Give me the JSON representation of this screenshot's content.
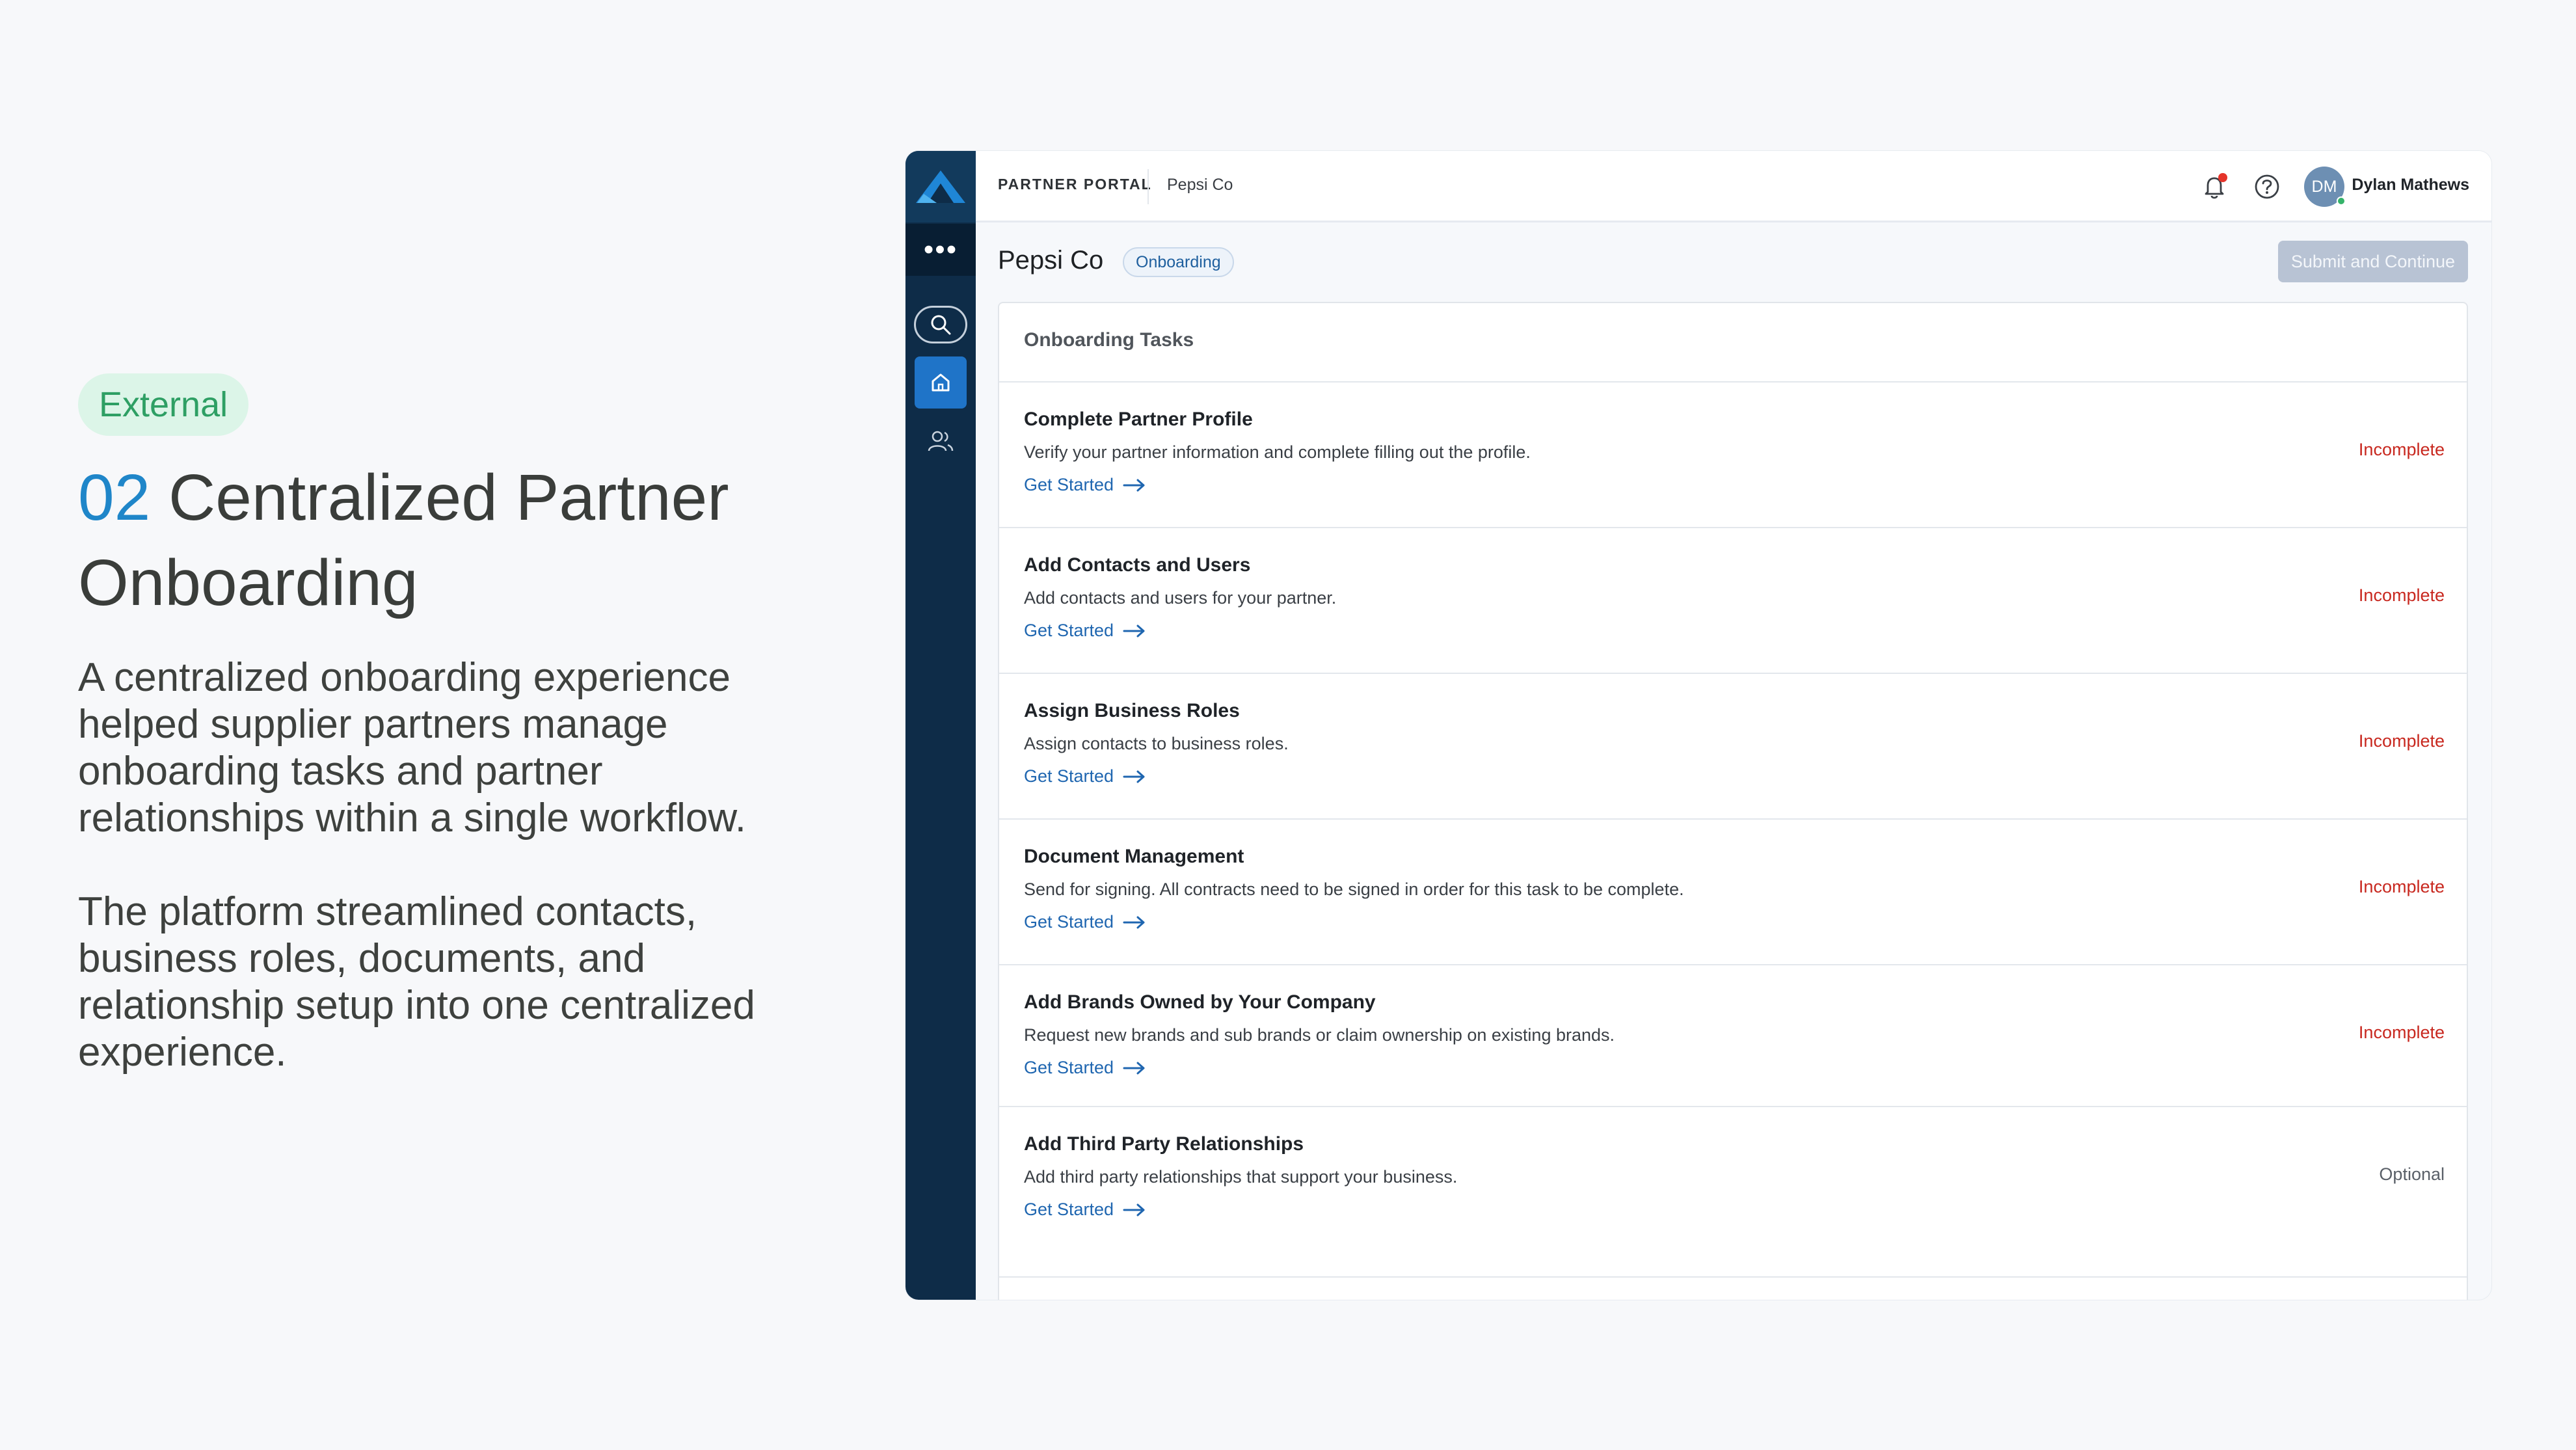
{
  "slide": {
    "tag": "External",
    "number": "02",
    "headline": "Centralized Partner Onboarding",
    "paragraph1": "A centralized onboarding experience helped supplier partners manage onboarding tasks and partner relationships within a single workflow.",
    "paragraph2": "The platform streamlined contacts, business roles, documents, and relationship setup into one centralized experience."
  },
  "app": {
    "header": {
      "portal_label": "PARTNER PORTAL",
      "company": "Pepsi Co",
      "user_initials": "DM",
      "user_name": "Dylan Mathews"
    },
    "page": {
      "title": "Pepsi Co",
      "status": "Onboarding",
      "submit_label": "Submit and Continue"
    },
    "panel_title": "Onboarding Tasks",
    "tasks": [
      {
        "title": "Complete Partner Profile",
        "description": "Verify your partner information and complete filling out the profile.",
        "link": "Get Started",
        "status": "Incomplete"
      },
      {
        "title": "Add Contacts and Users",
        "description": "Add contacts and users for your partner.",
        "link": "Get Started",
        "status": "Incomplete"
      },
      {
        "title": "Assign Business Roles",
        "description": "Assign contacts to business roles.",
        "link": "Get Started",
        "status": "Incomplete"
      },
      {
        "title": "Document Management",
        "description": "Send for signing. All contracts need to be signed in order for this task to be complete.",
        "link": "Get Started",
        "status": "Incomplete"
      },
      {
        "title": "Add Brands Owned by Your Company",
        "description": "Request new brands and sub brands or claim ownership on existing brands.",
        "link": "Get Started",
        "status": "Incomplete"
      },
      {
        "title": "Add Third Party Relationships",
        "description": "Add third party relationships that support your business.",
        "link": "Get Started",
        "status": "Optional"
      }
    ],
    "icons": {
      "logo": "brand-logo-icon",
      "more": "more-icon",
      "search": "search-icon",
      "home": "home-icon",
      "users": "users-icon",
      "notifications": "bell-icon",
      "help": "help-icon",
      "arrow": "arrow-right-icon"
    },
    "colors": {
      "rail": "#0e2c48",
      "accent": "#1f74c8",
      "incomplete": "#c8281f",
      "tag_bg": "#dcf5e8",
      "tag_text": "#2e9f64"
    }
  }
}
